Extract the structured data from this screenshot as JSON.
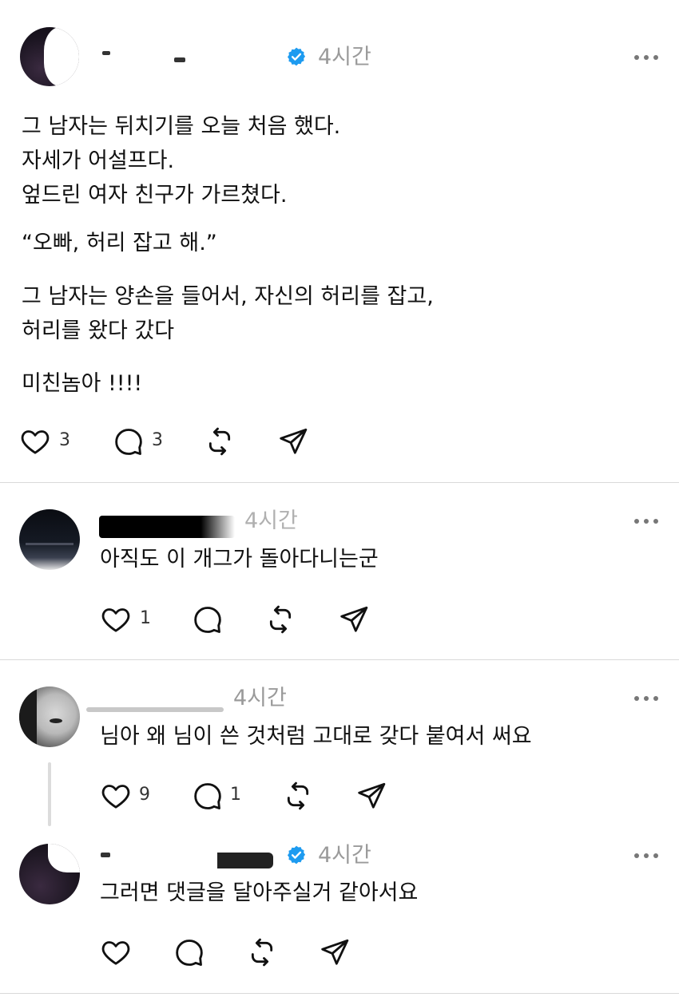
{
  "colors": {
    "verified": "#1d9bf0",
    "muted": "#9a9a9a",
    "divider": "#d9d9d9"
  },
  "post": {
    "time": "4시간",
    "verified_icon": "verified-badge-icon",
    "lines": [
      "그 남자는 뒤치기를 오늘 처음 했다.",
      "자세가 어설프다.",
      "엎드린 여자 친구가 가르쳤다.",
      "“오빠, 허리 잡고 해.”",
      "그 남자는 양손을 들어서, 자신의 허리를 잡고,",
      "허리를 왔다 갔다",
      "미친놈아 !!!!"
    ],
    "likes": "3",
    "comments": "3"
  },
  "replies": [
    {
      "time": "4시간",
      "text": "아직도 이 개그가 돌아다니는군",
      "likes": "1",
      "comments": ""
    },
    {
      "time": "4시간",
      "text": "님아 왜 님이 쓴 것처럼 고대로 갖다 붙여서 써요",
      "likes": "9",
      "comments": "1"
    },
    {
      "time": "4시간",
      "text": "그러면 댓글을 달아주실거 같아서요",
      "likes": "",
      "comments": ""
    }
  ]
}
